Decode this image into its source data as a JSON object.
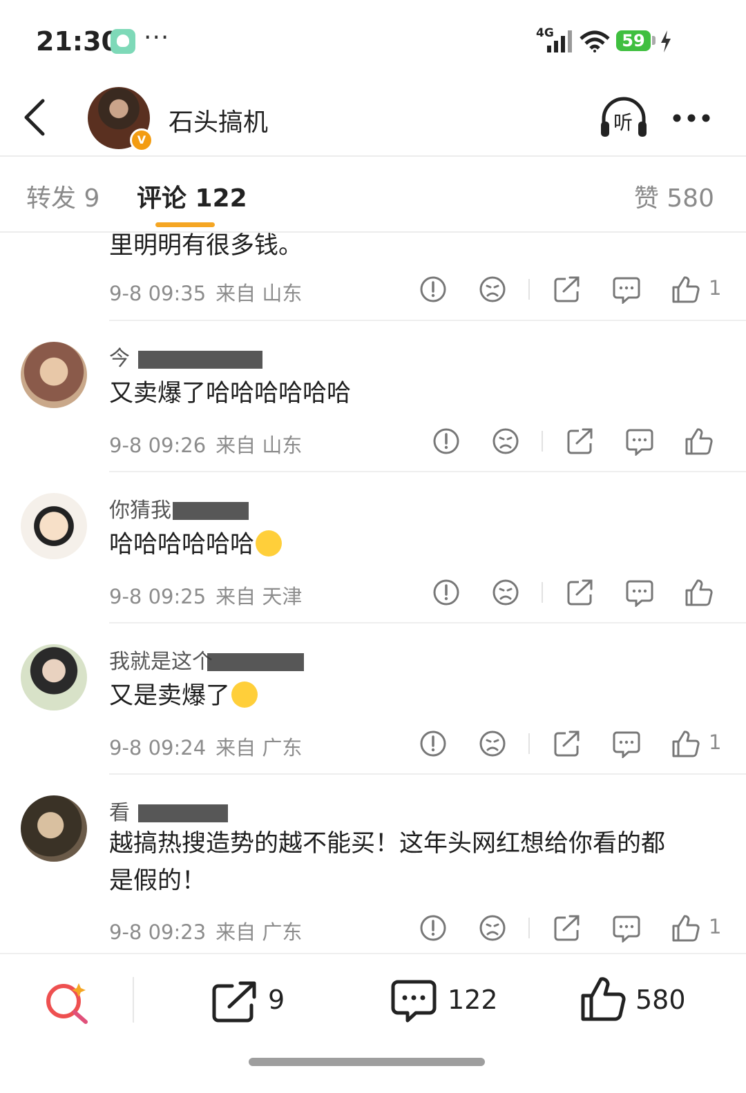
{
  "status_bar": {
    "time": "21:30",
    "more": "···",
    "network": "4G",
    "battery": "59",
    "icons": [
      "app-icon",
      "signal-icon",
      "wifi-icon",
      "battery-icon",
      "charging-icon"
    ]
  },
  "header": {
    "author": "石头搞机",
    "listen_label": "听",
    "icons": [
      "back-icon",
      "avatar",
      "verified-icon",
      "headphones-icon",
      "more-icon"
    ]
  },
  "tabs": {
    "forward": "转发 9",
    "comment": "评论 122",
    "like": "赞 580"
  },
  "comments": [
    {
      "name": "",
      "text": "里明明有很多钱。",
      "time": "9-8 09:35",
      "from": "来自 山东",
      "likes": "1"
    },
    {
      "name": "今",
      "text": "又卖爆了哈哈哈哈哈哈",
      "time": "9-8 09:26",
      "from": "来自 山东",
      "likes": ""
    },
    {
      "name": "你猜我",
      "text": "哈哈哈哈哈哈",
      "emoji": "laughing-emoji",
      "time": "9-8 09:25",
      "from": "来自 天津",
      "likes": ""
    },
    {
      "name": "我就是这个",
      "text": "又是卖爆了",
      "emoji": "sweat-emoji",
      "time": "9-8 09:24",
      "from": "来自 广东",
      "likes": "1"
    },
    {
      "name": "看",
      "text": "越搞热搜造势的越不能买！这年头网红想给你看的都",
      "text2": "是假的！",
      "time": "9-8 09:23",
      "from": "来自 广东",
      "likes": "1"
    }
  ],
  "bottom_bar": {
    "forward_count": "9",
    "comment_count": "122",
    "like_count": "580",
    "icons": [
      "ai-search-icon",
      "share-icon",
      "comment-icon",
      "like-icon"
    ]
  },
  "colors": {
    "accent": "#f5a623",
    "muted": "#8c8c8c",
    "battery": "#3fbf3f"
  }
}
